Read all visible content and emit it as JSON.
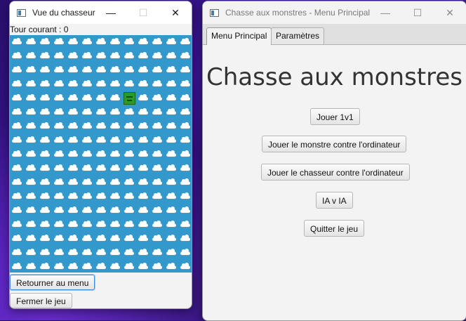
{
  "hunter_window": {
    "title": "Vue du chasseur",
    "turn_label": "Tour courant : 0",
    "grid": {
      "columns": 13,
      "rows": 17,
      "hunter_row": 4,
      "hunter_col": 8
    },
    "back_button": "Retourner au menu",
    "close_game_button": "Fermer le jeu",
    "colors": {
      "water": "#3399cc",
      "hunter": "#2a9a2a"
    }
  },
  "menu_window": {
    "title": "Chasse aux monstres - Menu Principal",
    "tabs": [
      {
        "label": "Menu Principal",
        "selected": true
      },
      {
        "label": "Paramètres",
        "selected": false
      }
    ],
    "heading": "Chasse aux monstres",
    "buttons": {
      "play_1v1": "Jouer 1v1",
      "monster_vs_ai": "Jouer le monstre contre l'ordinateur",
      "hunter_vs_ai": "Jouer le chasseur contre l'ordinateur",
      "ai_vs_ai": "IA v IA",
      "quit": "Quitter le jeu"
    }
  },
  "caption_glyphs": {
    "minimize": "—",
    "maximize": "☐",
    "close": "✕"
  }
}
